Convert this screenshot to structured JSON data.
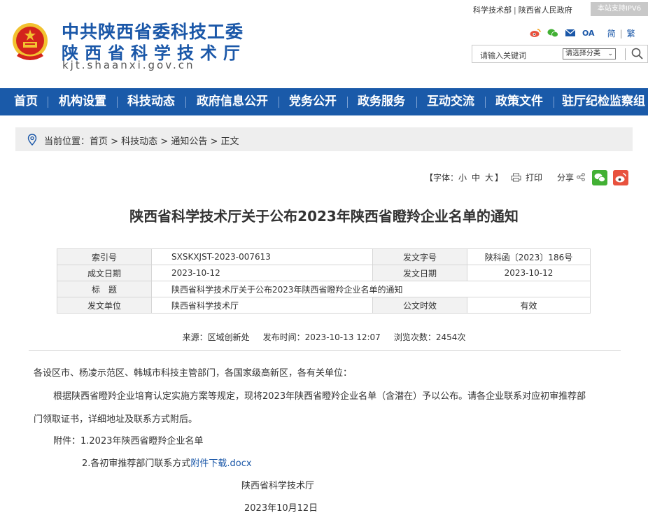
{
  "header": {
    "title_line1": "中共陕西省委科技工委",
    "title_line2": "陕西省科学技术厅",
    "site_url": "kjt.shaanxi.gov.cn",
    "top_links": [
      "科学技术部",
      "陕西省人民政府"
    ],
    "ipv6_badge": "本站支持IPV6",
    "oa_label": "OA",
    "lang_simplified": "简",
    "lang_traditional": "繁",
    "search_placeholder": "请输入关键词",
    "search_category": "请选择分类",
    "colors": {
      "brand_blue": "#1a57a8",
      "nav_blue": "#1a5aa9",
      "emblem_red": "#d3241c",
      "emblem_gold": "#f2c230"
    }
  },
  "nav": {
    "items": [
      "首页",
      "机构设置",
      "科技动态",
      "政府信息公开",
      "党务公开",
      "政务服务",
      "互动交流",
      "政策文件",
      "驻厅纪检监察组"
    ]
  },
  "breadcrumb": {
    "prefix": "当前位置：",
    "path": "首页 > 科技动态 > 通知公告 > 正文"
  },
  "tools": {
    "font_label": "【字体：",
    "font_small": "小",
    "font_medium": "中",
    "font_large": "大",
    "font_close": "】",
    "print": "打印",
    "share": "分享"
  },
  "article": {
    "title": "陕西省科学技术厅关于公布2023年陕西省瞪羚企业名单的通知",
    "meta": {
      "index_label": "索引号",
      "index_value": "SXSKXJST-2023-007613",
      "doc_no_label": "发文字号",
      "doc_no_value": "陕科函〔2023〕186号",
      "created_label": "成文日期",
      "created_value": "2023-10-12",
      "issued_label": "发文日期",
      "issued_value": "2023-10-12",
      "subject_label": "标　题",
      "subject_value": "陕西省科学技术厅关于公布2023年陕西省瞪羚企业名单的通知",
      "issuer_label": "发文单位",
      "issuer_value": "陕西省科学技术厅",
      "validity_label": "公文时效",
      "validity_value": "有效"
    },
    "source": "来源：区域创新处",
    "publish_time": "发布时间：2023-10-13 12:07",
    "views": "浏览次数：2454次",
    "salutation": "各设区市、杨凌示范区、韩城市科技主管部门，各国家级高新区，各有关单位：",
    "body_line1": "根据陕西省瞪羚企业培育认定实施方案等规定，现将2023年陕西省瞪羚企业名单（含潜在）予以公布。请各企业联系对应初审推荐部",
    "body_line2": "门领取证书，详细地址及联系方式附后。",
    "attachment1": "附件：1.2023年陕西省瞪羚企业名单",
    "attachment2_prefix": "2.各初审推荐部门联系方式",
    "attachment2_link": "附件下载.docx",
    "signature": "陕西省科学技术厅",
    "sign_date": "2023年10月12日"
  }
}
